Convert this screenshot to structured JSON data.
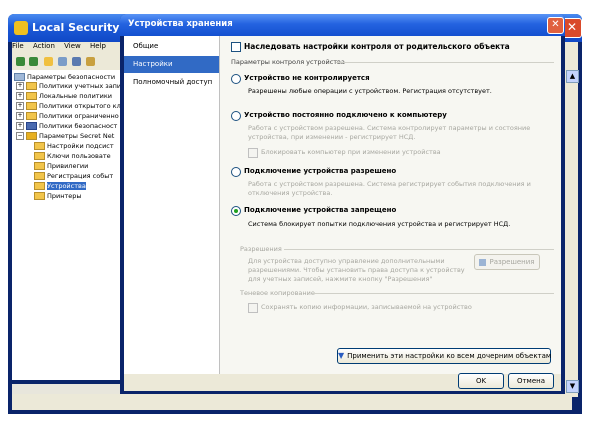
{
  "bg_window": {
    "title": "Local Security Settings",
    "menu": [
      "File",
      "Action",
      "View",
      "Help"
    ],
    "tree": [
      {
        "label": "Параметры безопасности",
        "level": 0,
        "exp": "",
        "icon": "computer"
      },
      {
        "label": "Политики учетных запи",
        "level": 1,
        "exp": "+",
        "icon": "folder"
      },
      {
        "label": "Локальные политики",
        "level": 1,
        "exp": "+",
        "icon": "folder"
      },
      {
        "label": "Политики открытого кл",
        "level": 1,
        "exp": "+",
        "icon": "folder"
      },
      {
        "label": "Политики ограниченно",
        "level": 1,
        "exp": "+",
        "icon": "folder"
      },
      {
        "label": "Политики безопасност",
        "level": 1,
        "exp": "+",
        "icon": "folder"
      },
      {
        "label": "Параметры Secret Net",
        "level": 1,
        "exp": "-",
        "icon": "folder"
      },
      {
        "label": "Настройки подсист",
        "level": 2,
        "exp": "",
        "icon": "folder"
      },
      {
        "label": "Ключи пользовате",
        "level": 2,
        "exp": "",
        "icon": "folder"
      },
      {
        "label": "Привилегии",
        "level": 2,
        "exp": "",
        "icon": "folder"
      },
      {
        "label": "Регистрация событ",
        "level": 2,
        "exp": "",
        "icon": "folder"
      },
      {
        "label": "Устройства",
        "level": 2,
        "exp": "",
        "icon": "folder",
        "selected": true
      },
      {
        "label": "Принтеры",
        "level": 2,
        "exp": "",
        "icon": "folder"
      }
    ]
  },
  "dialog": {
    "title": "Устройства хранения",
    "nav": [
      "Общие",
      "Настройки",
      "Полномочный доступ"
    ],
    "nav_active": 1,
    "inherit_label": "Наследовать настройки контроля от родительского объекта",
    "group_params": "Параметры контроля устройства",
    "options": [
      {
        "label": "Устройство не контролируется",
        "desc": [
          "Разрешены любые операции с устройством. Регистрация отсутствует."
        ],
        "selected": false
      },
      {
        "label": "Устройство постоянно подключено к компьютеру",
        "desc": [
          "Работа с устройством разрешена. Система контролирует параметры и состояние",
          "устройства, при изменении - регистрирует НСД."
        ],
        "selected": false,
        "sub_check": "Блокировать компьютер при изменении устройства"
      },
      {
        "label": "Подключение устройства разрешено",
        "desc": [
          "Работа с устройством разрешена. Система регистрирует события подключения и",
          "отключения устройства."
        ],
        "selected": false
      },
      {
        "label": "Подключение устройства запрещено",
        "desc": [
          "Система блокирует попытки подключения устройства и регистрирует НСД."
        ],
        "selected": true
      }
    ],
    "permissions": {
      "group": "Разрешения",
      "text": [
        "Для устройства доступно управление дополнительными",
        "разрешениями. Чтобы установить права доступа к устройству",
        "для учетных записей, нажмите кнопку \"Разрешения\""
      ],
      "button": "Разрешения"
    },
    "shadow": {
      "group": "Теневое копирование",
      "check": "Сохранять копию информации, записываемой на устройство"
    },
    "apply_button": "Применить эти настройки ко всем дочерним объектам",
    "ok": "OK",
    "cancel": "Отмена",
    "colors": {
      "accent": "#316ac5",
      "titlebar": "#2463e0",
      "face": "#ece9d8"
    }
  }
}
